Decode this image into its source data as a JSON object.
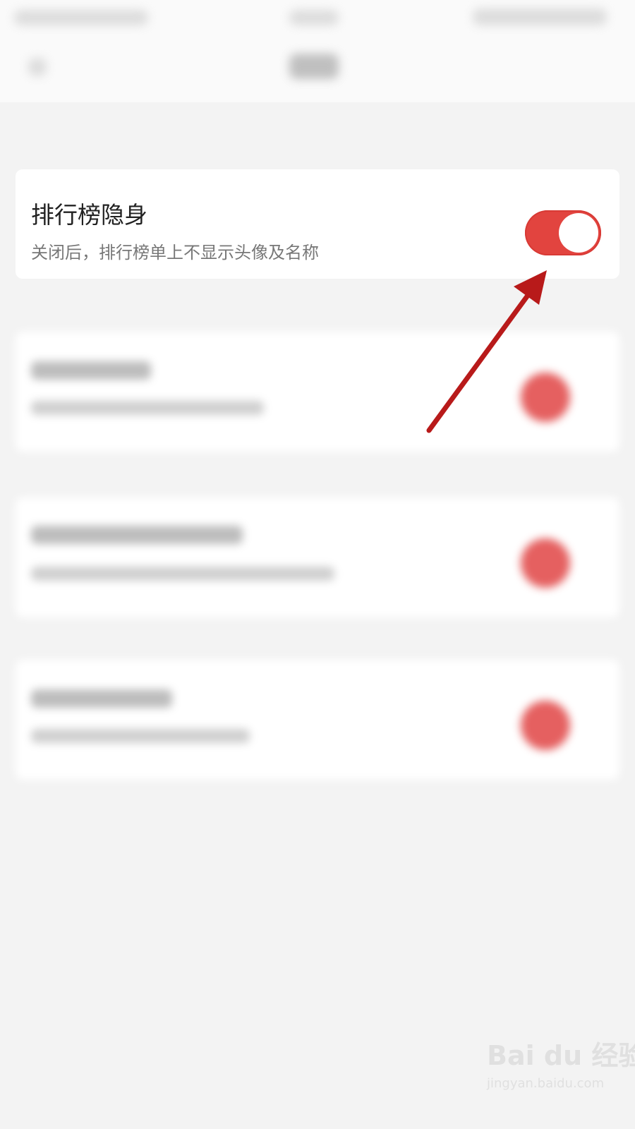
{
  "header": {
    "status_bar": "",
    "nav_title": ""
  },
  "settings": [
    {
      "title": "排行榜隐身",
      "description": "关闭后，排行榜单上不显示头像及名称",
      "enabled": true
    }
  ],
  "colors": {
    "accent": "#e2443f",
    "arrow": "#b81a1a",
    "background": "#f3f3f3"
  },
  "watermark": {
    "logo": "Bai du 经验",
    "site": "jingyan.baidu.com"
  }
}
